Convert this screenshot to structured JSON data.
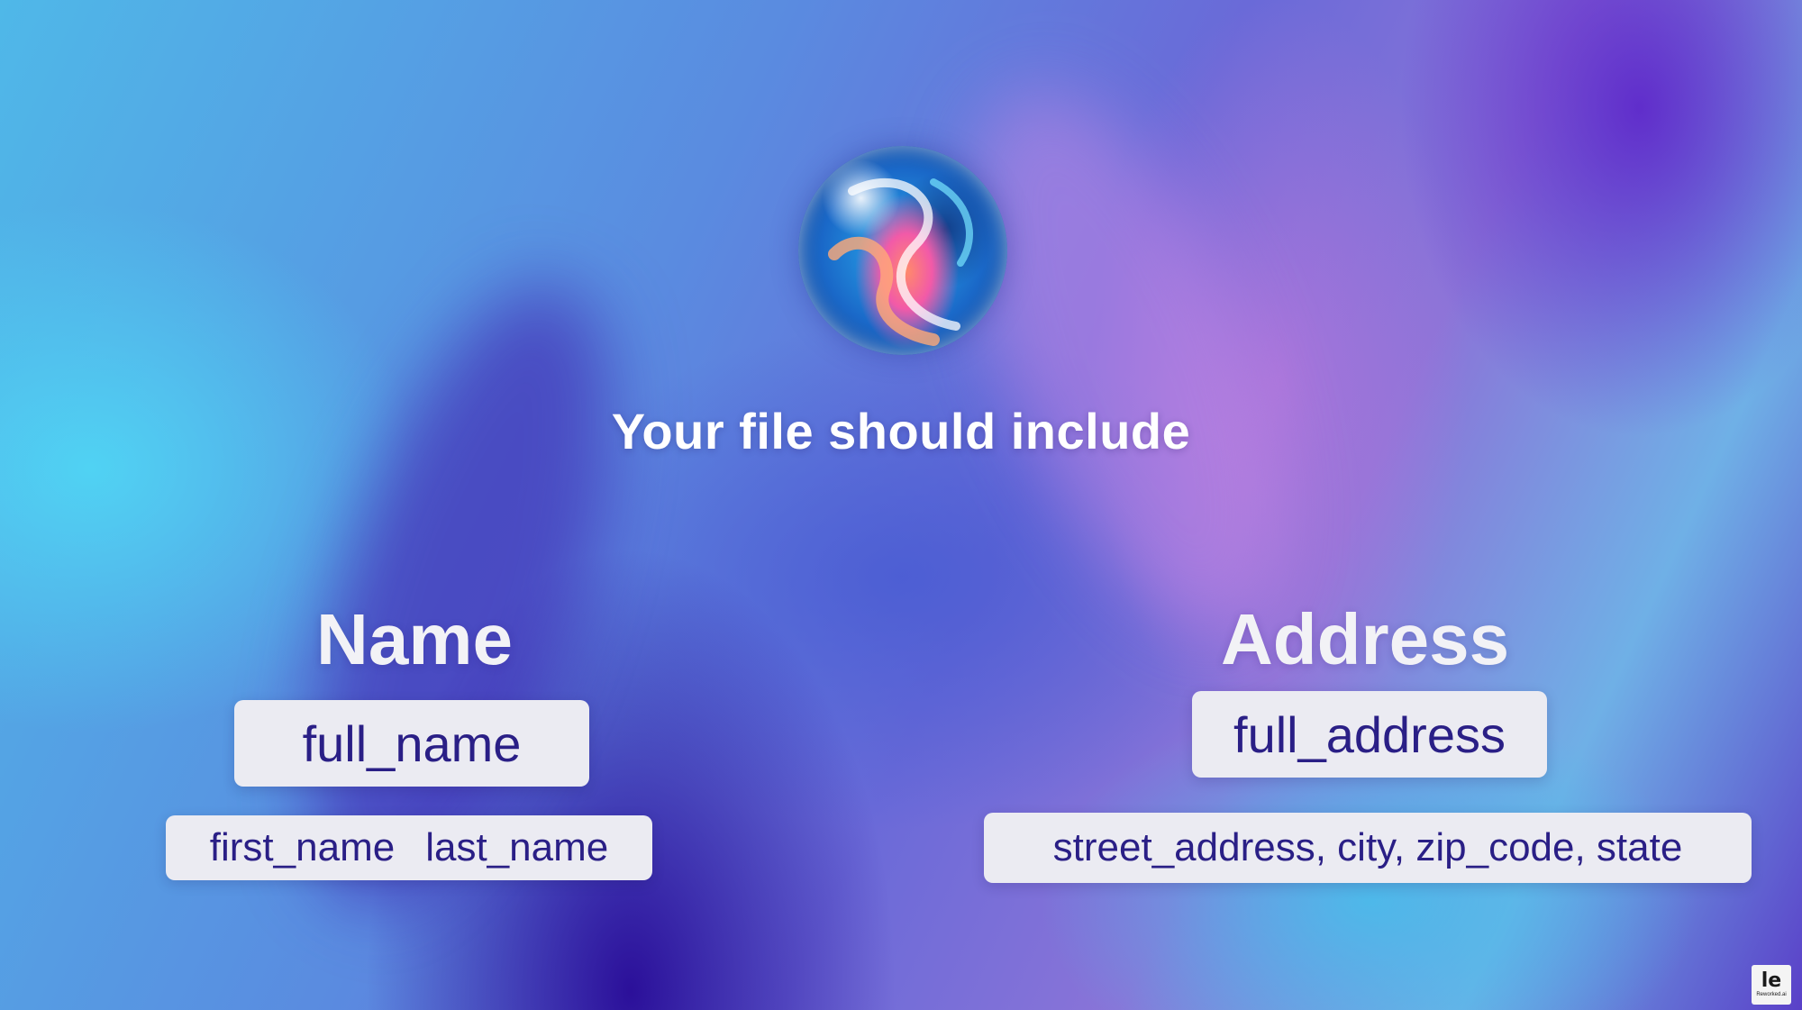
{
  "headline": "Your file should include",
  "columns": {
    "name": {
      "title": "Name",
      "primary": "full_name",
      "parts": [
        "first_name",
        "last_name"
      ]
    },
    "address": {
      "title": "Address",
      "primary": "full_address",
      "parts": "street_address, city, zip_code, state"
    }
  },
  "watermark": {
    "mark": "le",
    "brand": "Reworked.ai"
  },
  "colors": {
    "pill_background": "#ebebf2",
    "pill_text": "#2a1f86",
    "heading_text": "#ffffff"
  },
  "icons": {
    "orb": "swirl-orb-logo"
  }
}
